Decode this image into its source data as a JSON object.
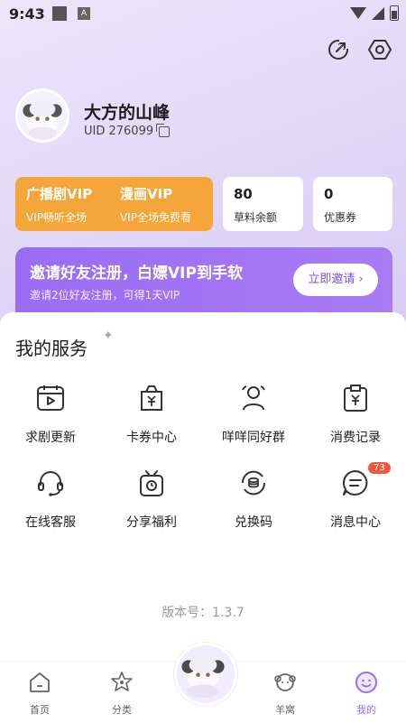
{
  "status_bar": {
    "time": "9:43",
    "icon_a": "A"
  },
  "profile": {
    "name": "大方的山峰",
    "uid": "UID 276099"
  },
  "vip": [
    {
      "title": "广播剧VIP",
      "subtitle": "VIP畅听全场"
    },
    {
      "title": "漫画VIP",
      "subtitle": "VIP全场免费看"
    }
  ],
  "stats": [
    {
      "value": "80",
      "label": "草料余额"
    },
    {
      "value": "0",
      "label": "优惠券"
    }
  ],
  "invite": {
    "title": "邀请好友注册，白嫖VIP到手软",
    "subtitle": "邀请2位好友注册，可得1天VIP",
    "button": "立即邀请"
  },
  "services": {
    "title": "我的服务",
    "items": [
      {
        "label": "求剧更新",
        "icon": "calendar-play-icon"
      },
      {
        "label": "卡券中心",
        "icon": "coupon-bag-icon"
      },
      {
        "label": "咩咩同好群",
        "icon": "group-icon"
      },
      {
        "label": "消费记录",
        "icon": "receipt-icon"
      },
      {
        "label": "在线客服",
        "icon": "headset-icon"
      },
      {
        "label": "分享福利",
        "icon": "gift-icon"
      },
      {
        "label": "兑换码",
        "icon": "coin-exchange-icon"
      },
      {
        "label": "消息中心",
        "icon": "message-icon",
        "badge": "73"
      }
    ]
  },
  "version": "版本号：1.3.7",
  "nav": [
    {
      "label": "首页",
      "icon": "home-icon"
    },
    {
      "label": "分类",
      "icon": "category-icon"
    },
    {
      "label": "羊窝",
      "icon": "sheep-icon"
    },
    {
      "label": "我的",
      "icon": "profile-smile-icon"
    }
  ],
  "colors": {
    "accent": "#9a6cf3",
    "vip": "#f5a63a",
    "badge": "#f0553f"
  }
}
